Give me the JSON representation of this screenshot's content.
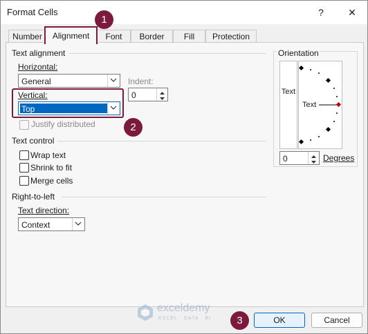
{
  "window": {
    "title": "Format Cells",
    "help_label": "?",
    "close_label": "✕"
  },
  "tabs": [
    {
      "label": "Number"
    },
    {
      "label": "Alignment"
    },
    {
      "label": "Font"
    },
    {
      "label": "Border"
    },
    {
      "label": "Fill"
    },
    {
      "label": "Protection"
    }
  ],
  "text_alignment": {
    "title": "Text alignment",
    "horizontal": {
      "label": "Horizontal:",
      "value": "General"
    },
    "indent": {
      "label": "Indent:",
      "value": "0"
    },
    "vertical": {
      "label": "Vertical:",
      "value": "Top"
    },
    "justify_distributed": {
      "label": "Justify distributed",
      "checked": false,
      "enabled": false
    }
  },
  "text_control": {
    "title": "Text control",
    "wrap_text": {
      "label": "Wrap text",
      "checked": false
    },
    "shrink_to_fit": {
      "label": "Shrink to fit",
      "checked": false
    },
    "merge_cells": {
      "label": "Merge cells",
      "checked": false
    }
  },
  "right_to_left": {
    "title": "Right-to-left",
    "direction": {
      "label": "Text direction:",
      "value": "Context"
    }
  },
  "orientation": {
    "title": "Orientation",
    "vertical_text": "Text",
    "dial_text": "Text",
    "degrees_value": "0",
    "degrees_label": "Degrees"
  },
  "watermark": {
    "brand": "exceldemy",
    "tagline": "EXCEL · DATA · BI"
  },
  "callouts": [
    "1",
    "2",
    "3"
  ],
  "buttons": {
    "ok": "OK",
    "cancel": "Cancel"
  },
  "colors": {
    "accent": "#7b1a3c",
    "selection": "#0067c0",
    "ok_border": "#0067c0"
  }
}
